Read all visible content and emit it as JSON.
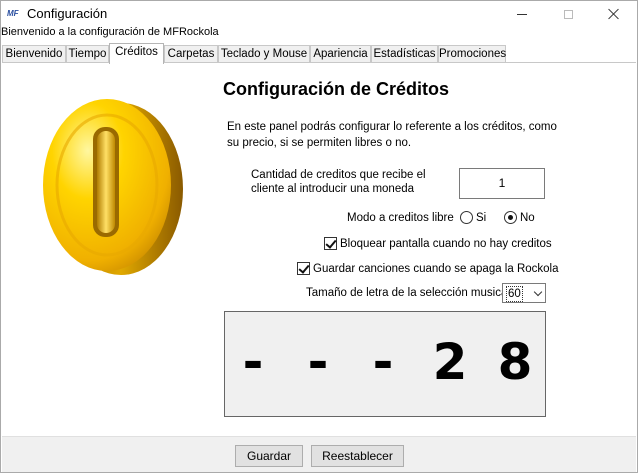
{
  "window": {
    "icon": "MF",
    "title": "Configuración",
    "minimize_icon": "minimize-icon",
    "maximize_icon": "maximize-icon",
    "close_icon": "close-icon"
  },
  "welcome": "Bienvenido a la configuración de MFRockola",
  "tabs": [
    {
      "label": "Bienvenido",
      "active": false
    },
    {
      "label": "Tiempo",
      "active": false
    },
    {
      "label": "Créditos",
      "active": true
    },
    {
      "label": "Carpetas",
      "active": false
    },
    {
      "label": "Teclado y Mouse",
      "active": false
    },
    {
      "label": "Apariencia",
      "active": false
    },
    {
      "label": "Estadísticas",
      "active": false
    },
    {
      "label": "Promociones",
      "active": false
    }
  ],
  "panel": {
    "image": "gold-coin",
    "heading": "Configuración de Créditos",
    "description": "En este panel podrás configurar lo referente a los créditos, como su precio, si se permiten libres o no.",
    "credits_per_coin": {
      "label": "Cantidad de creditos que recibe el cliente al introducir una moneda",
      "value": "1"
    },
    "free_mode": {
      "label": "Modo a creditos libre",
      "options": [
        "Si",
        "No"
      ],
      "selected": "No"
    },
    "lock_screen": {
      "label": "Bloquear pantalla cuando no hay creditos",
      "checked": true
    },
    "save_songs": {
      "label": "Guardar canciones cuando se apaga la Rockola",
      "checked": true
    },
    "font_size": {
      "label": "Tamaño de letra de la selección musical",
      "value": "60"
    },
    "preview_digits": [
      "-",
      "-",
      "-",
      "2",
      "8"
    ]
  },
  "footer": {
    "save_label": "Guardar",
    "reset_label": "Reestablecer"
  }
}
